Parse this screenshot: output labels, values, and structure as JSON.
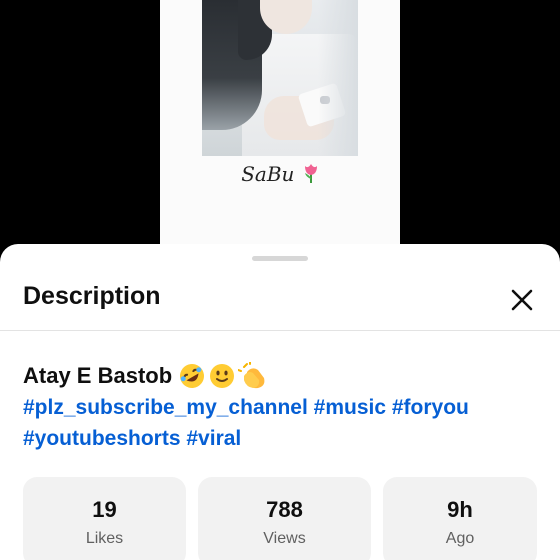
{
  "video": {
    "watermark_text": "SaBu",
    "watermark_emoji": "tulip-icon"
  },
  "sheet": {
    "title": "Description",
    "close_icon": "close-icon"
  },
  "description": {
    "title": "Atay E Bastob",
    "title_emojis": [
      "rolling-on-floor-laughing-emoji",
      "slightly-smiling-face-emoji",
      "clapping-hands-emoji"
    ],
    "hashtags": [
      "#plz_subscribe_my_channel",
      "#music",
      "#foryou",
      "#youtubeshorts",
      "#viral"
    ],
    "hashtag_color": "#065fd4"
  },
  "stats": {
    "likes": {
      "value": "19",
      "label": "Likes"
    },
    "views": {
      "value": "788",
      "label": "Views"
    },
    "age": {
      "value": "9h",
      "label": "Ago"
    }
  }
}
